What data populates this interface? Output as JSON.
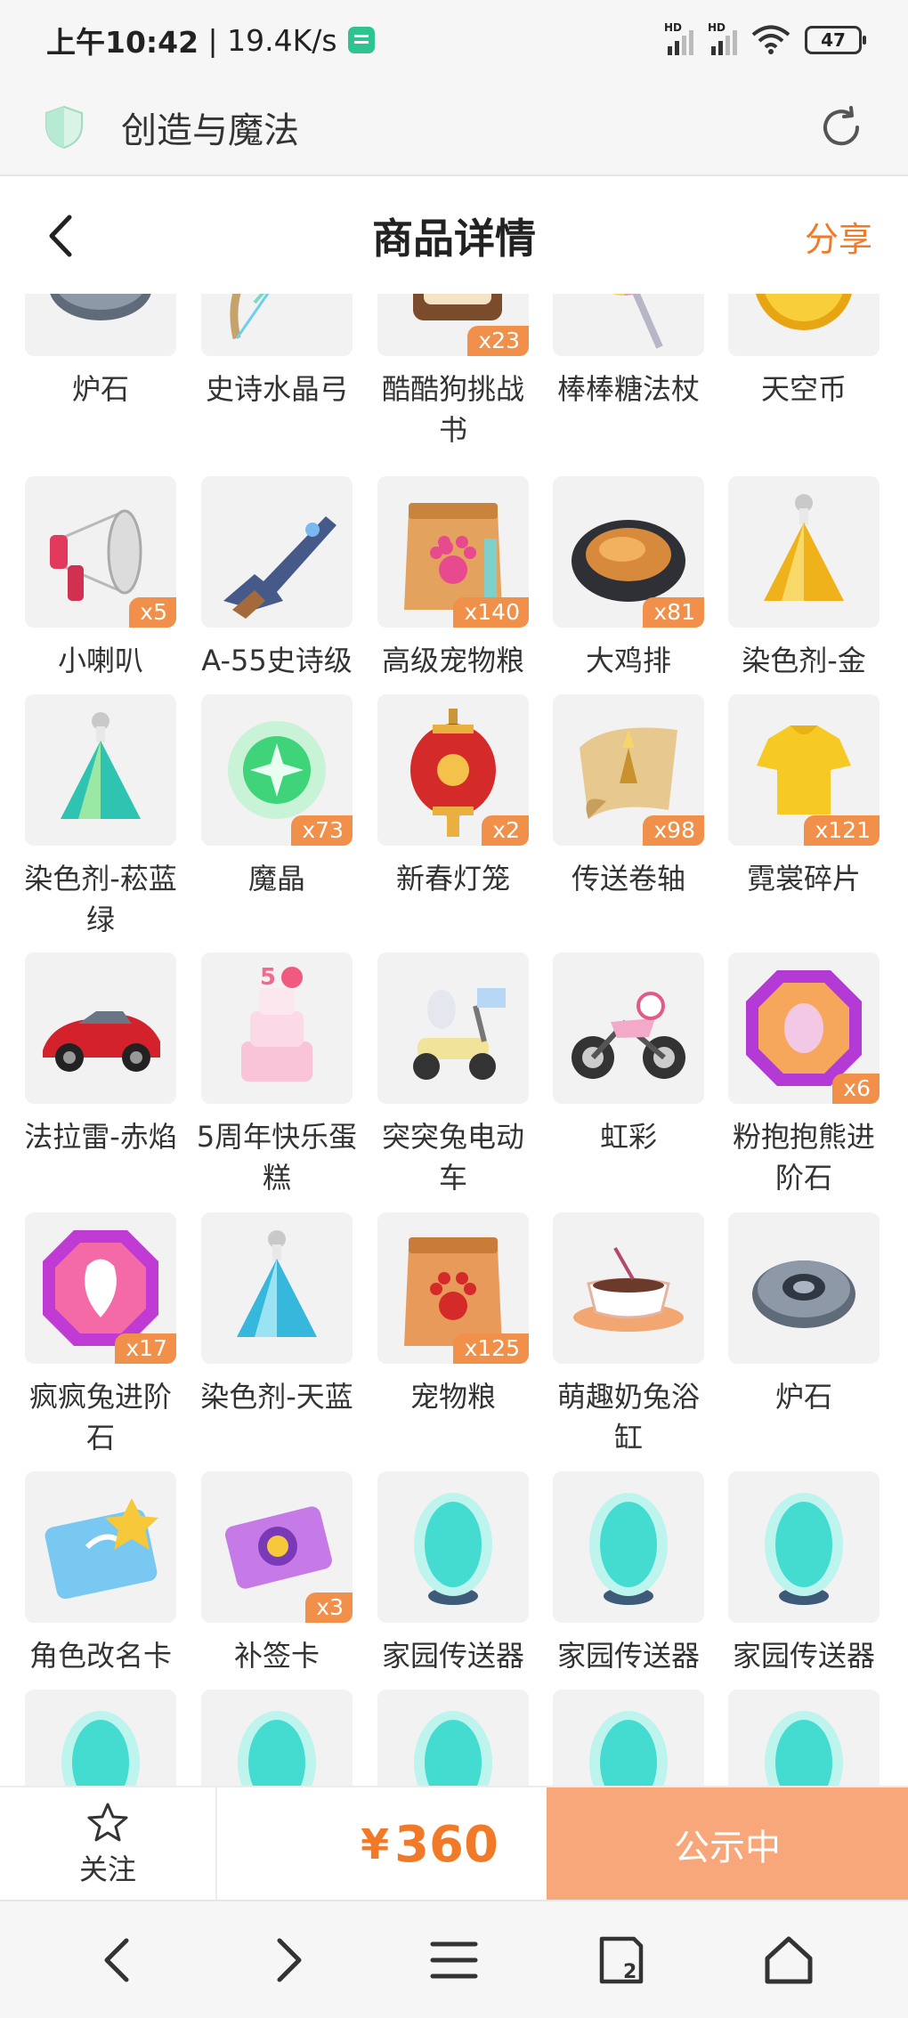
{
  "status_bar": {
    "time": "上午10:42",
    "net_speed": "19.4K/s",
    "signal_label": "HD",
    "battery": "47"
  },
  "browser": {
    "site_title": "创造与魔法"
  },
  "header": {
    "title": "商品详情",
    "share_label": "分享"
  },
  "items": [
    {
      "name": "炉石",
      "badge": "",
      "icon": "furnace-stone-icon",
      "row": 0,
      "col": 0
    },
    {
      "name": "史诗水晶弓",
      "badge": "",
      "icon": "crystal-bow-icon",
      "row": 0,
      "col": 1
    },
    {
      "name": "酷酷狗挑战书",
      "badge": "x23",
      "icon": "challenge-book-icon",
      "row": 0,
      "col": 2
    },
    {
      "name": "棒棒糖法杖",
      "badge": "",
      "icon": "lollipop-staff-icon",
      "row": 0,
      "col": 3
    },
    {
      "name": "天空币",
      "badge": "",
      "icon": "sky-coin-icon",
      "row": 0,
      "col": 4
    },
    {
      "name": "小喇叭",
      "badge": "x5",
      "icon": "megaphone-icon",
      "row": 1,
      "col": 0
    },
    {
      "name": "A-55史诗级",
      "badge": "",
      "icon": "rifle-icon",
      "row": 1,
      "col": 1
    },
    {
      "name": "高级宠物粮",
      "badge": "x140",
      "icon": "premium-pet-food-icon",
      "row": 1,
      "col": 2
    },
    {
      "name": "大鸡排",
      "badge": "x81",
      "icon": "chicken-cutlet-icon",
      "row": 1,
      "col": 3
    },
    {
      "name": "染色剂-金",
      "badge": "",
      "icon": "gold-dye-icon",
      "row": 1,
      "col": 4
    },
    {
      "name": "染色剂-菘蓝绿",
      "badge": "",
      "icon": "teal-dye-icon",
      "row": 2,
      "col": 0
    },
    {
      "name": "魔晶",
      "badge": "x73",
      "icon": "magic-crystal-icon",
      "row": 2,
      "col": 1
    },
    {
      "name": "新春灯笼",
      "badge": "x2",
      "icon": "lantern-icon",
      "row": 2,
      "col": 2
    },
    {
      "name": "传送卷轴",
      "badge": "x98",
      "icon": "teleport-scroll-icon",
      "row": 2,
      "col": 3
    },
    {
      "name": "霓裳碎片",
      "badge": "x121",
      "icon": "shirt-fragment-icon",
      "row": 2,
      "col": 4
    },
    {
      "name": "法拉雷-赤焰",
      "badge": "",
      "icon": "sports-car-icon",
      "row": 3,
      "col": 0
    },
    {
      "name": "5周年快乐蛋糕",
      "badge": "",
      "icon": "anniversary-cake-icon",
      "row": 3,
      "col": 1
    },
    {
      "name": "突突兔电动车",
      "badge": "",
      "icon": "scooter-icon",
      "row": 3,
      "col": 2
    },
    {
      "name": "虹彩",
      "badge": "",
      "icon": "motorcycle-icon",
      "row": 3,
      "col": 3
    },
    {
      "name": "粉抱抱熊进阶石",
      "badge": "x6",
      "icon": "pink-gem-icon",
      "row": 3,
      "col": 4
    },
    {
      "name": "疯疯兔进阶石",
      "badge": "x17",
      "icon": "rabbit-gem-icon",
      "row": 4,
      "col": 0
    },
    {
      "name": "染色剂-天蓝",
      "badge": "",
      "icon": "sky-blue-dye-icon",
      "row": 4,
      "col": 1
    },
    {
      "name": "宠物粮",
      "badge": "x125",
      "icon": "pet-food-icon",
      "row": 4,
      "col": 2
    },
    {
      "name": "萌趣奶兔浴缸",
      "badge": "",
      "icon": "teacup-bathtub-icon",
      "row": 4,
      "col": 3
    },
    {
      "name": "炉石",
      "badge": "",
      "icon": "furnace-stone-icon",
      "row": 4,
      "col": 4
    },
    {
      "name": "角色改名卡",
      "badge": "",
      "icon": "rename-card-icon",
      "row": 5,
      "col": 0
    },
    {
      "name": "补签卡",
      "badge": "x3",
      "icon": "makeup-ticket-icon",
      "row": 5,
      "col": 1
    },
    {
      "name": "家园传送器",
      "badge": "",
      "icon": "home-teleporter-icon",
      "row": 5,
      "col": 2
    },
    {
      "name": "家园传送器",
      "badge": "",
      "icon": "home-teleporter-icon",
      "row": 5,
      "col": 3
    },
    {
      "name": "家园传送器",
      "badge": "",
      "icon": "home-teleporter-icon",
      "row": 5,
      "col": 4
    },
    {
      "name": "",
      "badge": "",
      "icon": "home-teleporter-icon",
      "row": 6,
      "col": 0
    },
    {
      "name": "",
      "badge": "",
      "icon": "home-teleporter-icon",
      "row": 6,
      "col": 1
    },
    {
      "name": "",
      "badge": "",
      "icon": "home-teleporter-icon",
      "row": 6,
      "col": 2
    },
    {
      "name": "",
      "badge": "",
      "icon": "home-teleporter-icon",
      "row": 6,
      "col": 3
    },
    {
      "name": "",
      "badge": "",
      "icon": "home-teleporter-icon",
      "row": 6,
      "col": 4
    }
  ],
  "action_bar": {
    "follow_label": "关注",
    "currency": "¥",
    "price": "360",
    "status_label": "公示中"
  },
  "nav": {
    "tabs_count": "2"
  },
  "colors": {
    "accent": "#f07a28",
    "badge": "#f0904a",
    "status_button": "#f8a77a"
  }
}
